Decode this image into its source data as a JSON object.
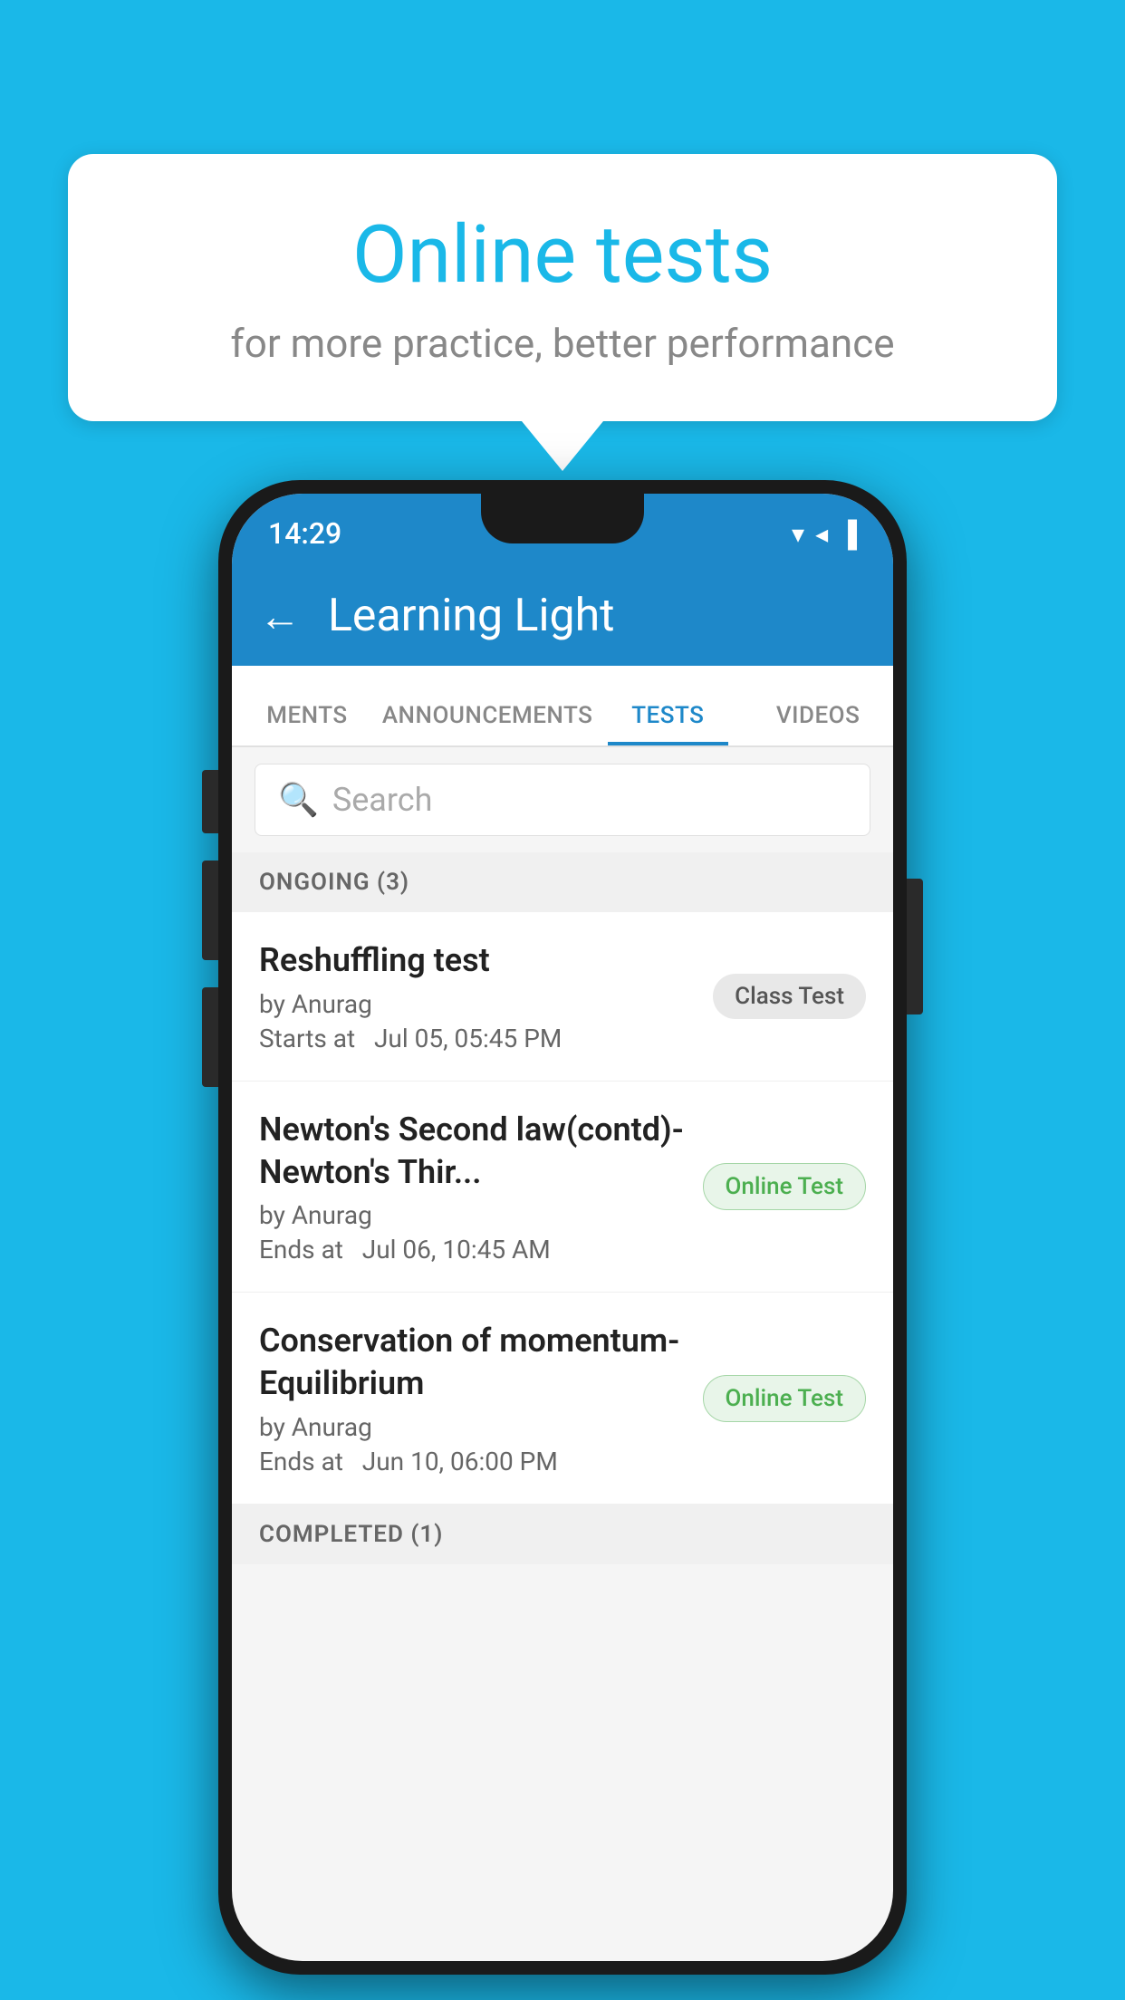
{
  "background": {
    "color": "#1ab8e8"
  },
  "speech_bubble": {
    "title": "Online tests",
    "subtitle": "for more practice, better performance"
  },
  "phone": {
    "status_bar": {
      "time": "14:29",
      "icons": [
        "▾",
        "◂",
        "▐"
      ]
    },
    "app_bar": {
      "back_label": "←",
      "title": "Learning Light"
    },
    "tabs": [
      {
        "label": "MENTS",
        "active": false
      },
      {
        "label": "ANNOUNCEMENTS",
        "active": false
      },
      {
        "label": "TESTS",
        "active": true
      },
      {
        "label": "VIDEOS",
        "active": false
      }
    ],
    "search": {
      "placeholder": "Search",
      "icon": "🔍"
    },
    "sections": [
      {
        "header": "ONGOING (3)",
        "items": [
          {
            "name": "Reshuffling test",
            "author": "by Anurag",
            "time_label": "Starts at",
            "time": "Jul 05, 05:45 PM",
            "badge": "Class Test",
            "badge_type": "class"
          },
          {
            "name": "Newton's Second law(contd)-Newton's Thir...",
            "author": "by Anurag",
            "time_label": "Ends at",
            "time": "Jul 06, 10:45 AM",
            "badge": "Online Test",
            "badge_type": "online"
          },
          {
            "name": "Conservation of momentum-Equilibrium",
            "author": "by Anurag",
            "time_label": "Ends at",
            "time": "Jun 10, 06:00 PM",
            "badge": "Online Test",
            "badge_type": "online"
          }
        ]
      },
      {
        "header": "COMPLETED (1)",
        "items": []
      }
    ]
  }
}
